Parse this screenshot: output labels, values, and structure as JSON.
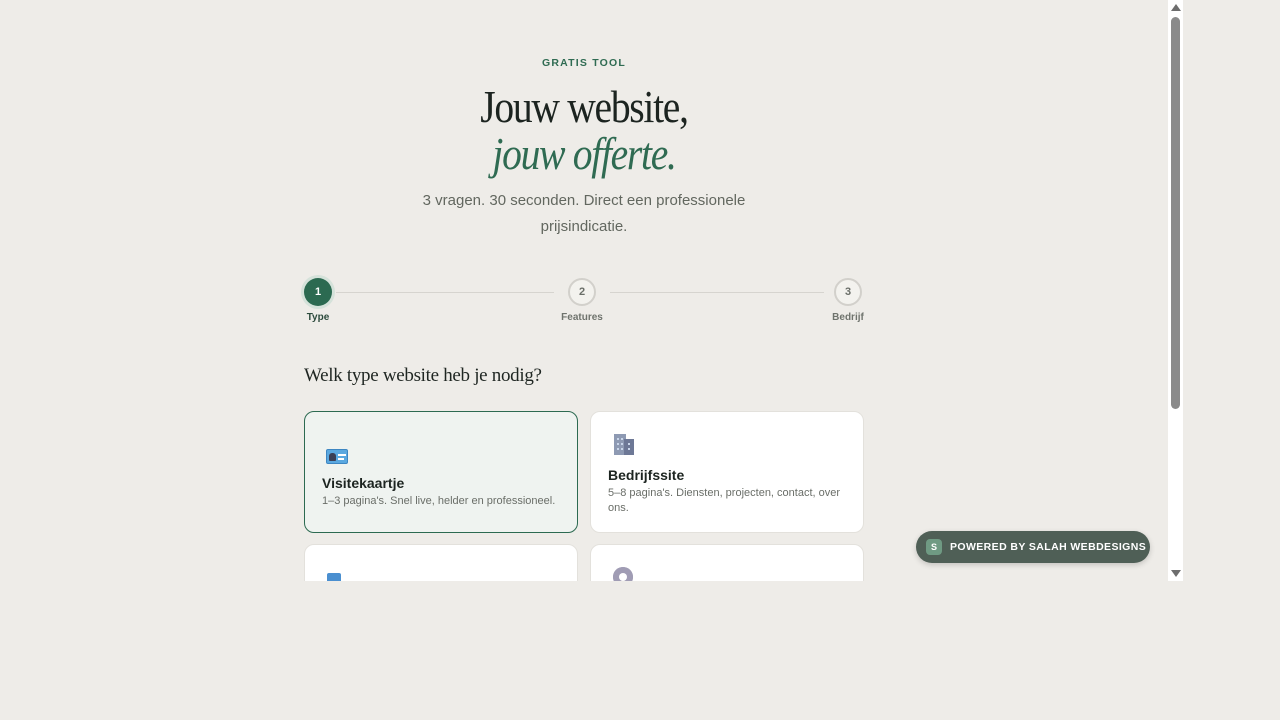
{
  "header": {
    "eyebrow": "GRATIS TOOL",
    "title_line1": "Jouw website,",
    "title_line2": "jouw offerte.",
    "subtitle": "3 vragen. 30 seconden. Direct een professionele prijsindicatie."
  },
  "stepper": {
    "steps": [
      {
        "number": "1",
        "label": "Type",
        "state": "active"
      },
      {
        "number": "2",
        "label": "Features",
        "state": "idle"
      },
      {
        "number": "3",
        "label": "Bedrijf",
        "state": "idle"
      }
    ]
  },
  "question": "Welk type website heb je nodig?",
  "options": [
    {
      "icon": "id-card-icon",
      "title": "Visitekaartje",
      "description": "1–3 pagina's. Snel live, helder en professioneel.",
      "selected": true
    },
    {
      "icon": "office-building-icon",
      "title": "Bedrijfssite",
      "description": "5–8 pagina's. Diensten, projecten, contact, over ons.",
      "selected": false
    },
    {
      "icon": "shopping-bag-icon",
      "title": "",
      "description": "",
      "selected": false
    },
    {
      "icon": "gear-icon",
      "title": "",
      "description": "",
      "selected": false
    }
  ],
  "badge": {
    "logo_letter": "S",
    "text": "POWERED BY SALAH WEBDESIGNS"
  },
  "colors": {
    "accent": "#2c6a51",
    "background": "#eeece8",
    "badge": "#4f5f56"
  }
}
